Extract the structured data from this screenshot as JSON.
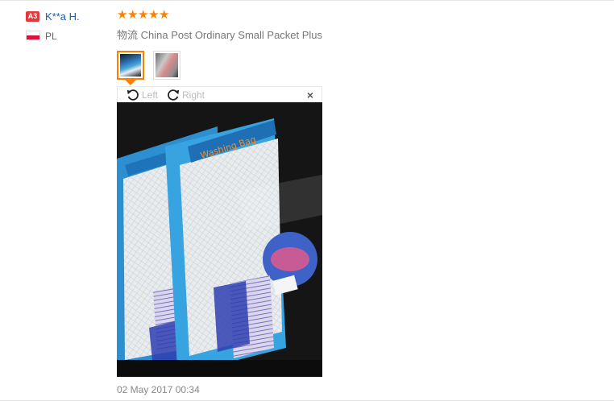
{
  "user": {
    "level_badge": "A3",
    "name": "K**a H.",
    "country": "PL"
  },
  "review": {
    "rating": 5,
    "rating_max": 5,
    "shipping": "物流 China Post Ordinary Small Packet Plus",
    "date": "02 May 2017 00:34"
  },
  "viewer": {
    "rotate_left_label": "Left",
    "rotate_right_label": "Right",
    "close_symbol": "×",
    "active_thumbnail": 1,
    "thumbnail_count": 2
  },
  "colors": {
    "star": "#ff7f00",
    "badge": "#e4393c",
    "username": "#1b5fa7"
  }
}
